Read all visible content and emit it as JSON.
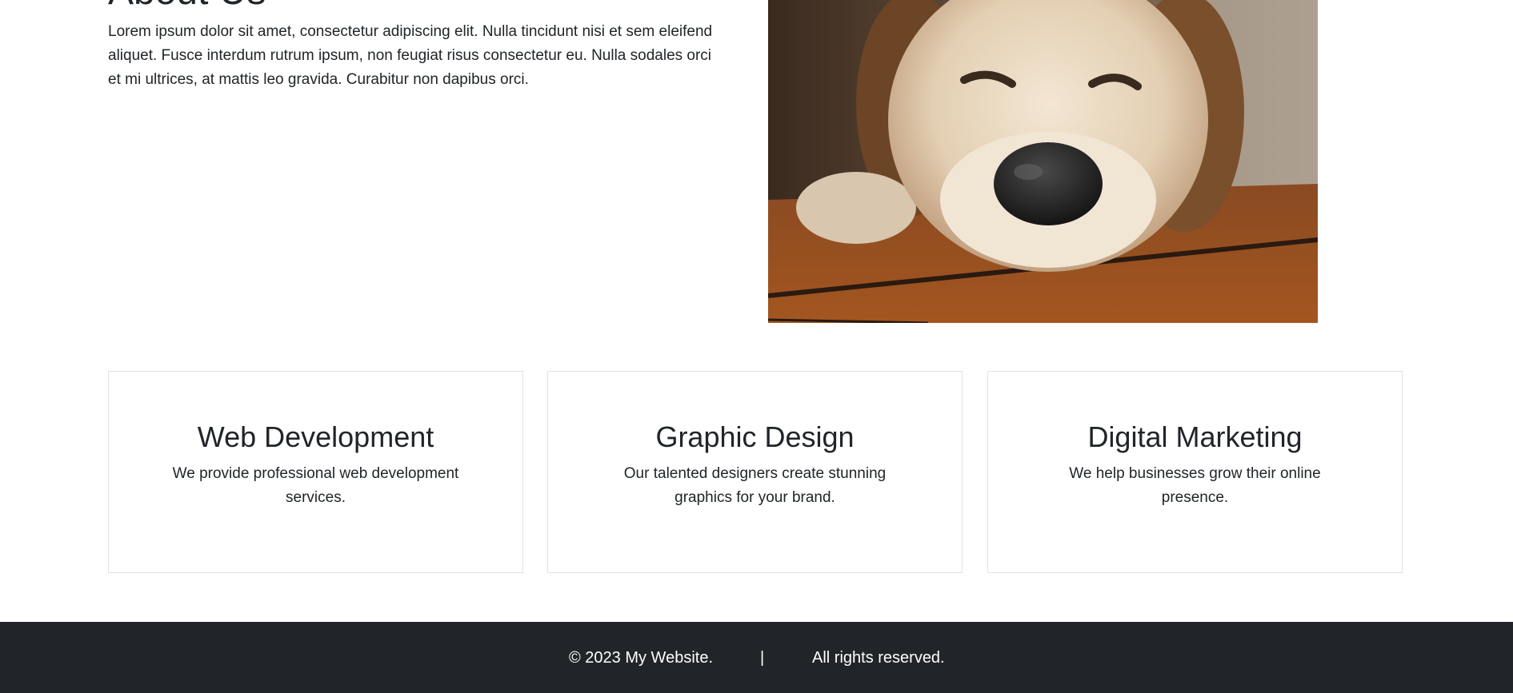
{
  "about": {
    "title": "About Us",
    "text": "Lorem ipsum dolor sit amet, consectetur adipiscing elit. Nulla tincidunt nisi et sem eleifend aliquet. Fusce interdum rutrum ipsum, non feugiat risus consectetur eu. Nulla sodales orci et mi ultrices, at mattis leo gravida. Curabitur non dapibus orci."
  },
  "services": [
    {
      "title": "Web Development",
      "text": "We provide professional web development services."
    },
    {
      "title": "Graphic Design",
      "text": "Our talented designers create stunning graphics for your brand."
    },
    {
      "title": "Digital Marketing",
      "text": "We help businesses grow their online presence."
    }
  ],
  "footer": {
    "copyright": "© 2023 My Website.",
    "separator": "|",
    "rights": "All rights reserved."
  },
  "colors": {
    "footer_bg": "#212529",
    "text": "#212529",
    "card_border": "#dee2e6"
  }
}
